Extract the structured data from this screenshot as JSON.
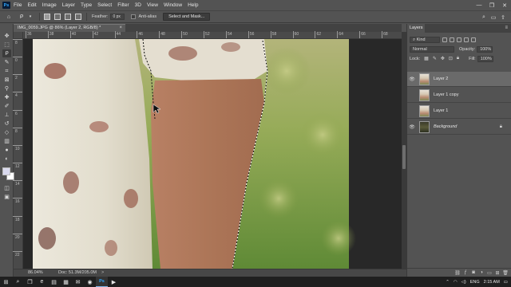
{
  "app": {
    "logo": "Ps"
  },
  "menu": [
    "File",
    "Edit",
    "Image",
    "Layer",
    "Type",
    "Select",
    "Filter",
    "3D",
    "View",
    "Window",
    "Help"
  ],
  "window_controls": {
    "minimize": "—",
    "maximize": "❐",
    "close": "✕"
  },
  "options_bar": {
    "feather_label": "Feather:",
    "feather_value": "0 px",
    "antialias_label": "Anti-alias",
    "select_mask_label": "Select and Mask..."
  },
  "document": {
    "tab_title": "IMG_0059.JPG @ 86% (Layer 2, RGB/8) *",
    "tab_close": "×"
  },
  "ruler": {
    "top": [
      "36",
      "38",
      "40",
      "42",
      "44",
      "46",
      "48",
      "50",
      "52",
      "54",
      "56",
      "58",
      "60",
      "62",
      "64",
      "66",
      "68"
    ],
    "left": [
      "8",
      "0",
      "2",
      "4",
      "6",
      "8",
      "10",
      "12",
      "14",
      "16",
      "18",
      "20",
      "22"
    ]
  },
  "status": {
    "zoom": "86.04%",
    "doc": "Doc: 51.3M/205.0M",
    "arrow": ">"
  },
  "layers_panel": {
    "tab": "Layers",
    "filter_kind": "Kind",
    "blend_mode": "Normal",
    "opacity_label": "Opacity:",
    "opacity_value": "100%",
    "lock_label": "Lock:",
    "fill_label": "Fill:",
    "fill_value": "100%",
    "layers": [
      {
        "name": "Layer 2",
        "visible": true,
        "selected": true
      },
      {
        "name": "Layer 1 copy",
        "visible": false,
        "selected": false
      },
      {
        "name": "Layer 1",
        "visible": false,
        "selected": false
      },
      {
        "name": "Background",
        "visible": true,
        "selected": false,
        "locked": true
      }
    ]
  },
  "taskbar": {
    "time": "2:15 AM",
    "language": "ENG"
  },
  "colors": {
    "foreground": "#d9d9ee",
    "background": "#ffffff",
    "accent": "#31a8ff"
  }
}
